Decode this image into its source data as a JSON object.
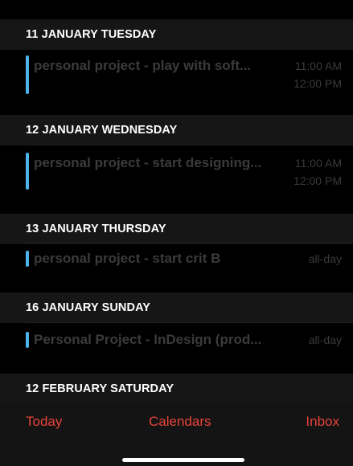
{
  "sections": [
    {
      "header": "11 JANUARY TUESDAY",
      "events": [
        {
          "title": "personal project - play with soft...",
          "time_start": "11:00 AM",
          "time_end": "12:00 PM"
        }
      ]
    },
    {
      "header": "12 JANUARY WEDNESDAY",
      "events": [
        {
          "title": "personal project - start designing...",
          "time_start": "11:00 AM",
          "time_end": "12:00 PM"
        }
      ]
    },
    {
      "header": "13 JANUARY THURSDAY",
      "events": [
        {
          "title": "personal project - start crit B",
          "time_start": "all-day"
        }
      ]
    },
    {
      "header": "16 JANUARY SUNDAY",
      "events": [
        {
          "title": "Personal Project - InDesign (prod...",
          "time_start": "all-day"
        }
      ]
    },
    {
      "header": "12 FEBRUARY SATURDAY",
      "events": []
    }
  ],
  "toolbar": {
    "today_label": "Today",
    "calendars_label": "Calendars",
    "inbox_label": "Inbox"
  },
  "colors": {
    "accent": "#e8433a",
    "event_bar": "#4fb3ec",
    "background": "#000000"
  }
}
